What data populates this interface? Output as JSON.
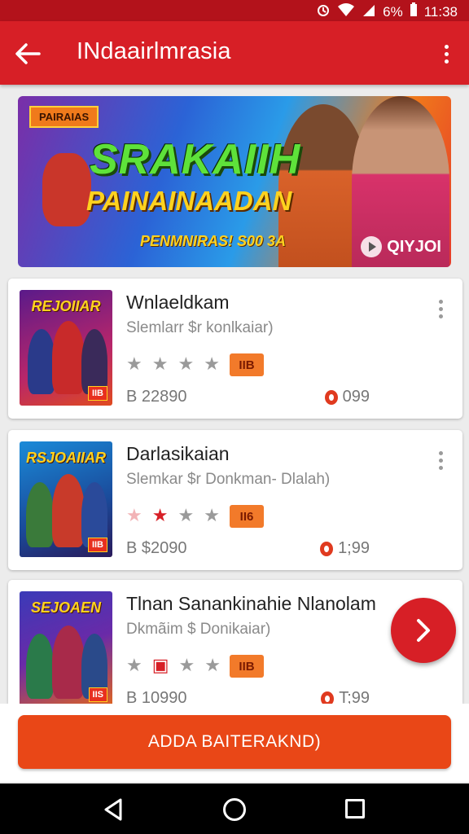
{
  "status_bar": {
    "percent": "6%",
    "time": "11:38"
  },
  "app_bar": {
    "title": "INdaairlmrasia"
  },
  "banner": {
    "tag": "PAIRAIAS",
    "title": "SRAKAIIH",
    "subtitle": "PAINAINAADAN",
    "footer": "PENMNIRAS! S00 3A",
    "play_label": "QIYJOI"
  },
  "games": [
    {
      "title": "Wnlaeldkam",
      "subtitle": "Slemlarr $r konlkaiar)",
      "thumb_title": "REJOIIAR",
      "thumb_badge": "IIB",
      "rating_badge": "IIB",
      "price_left": "B 22890",
      "price_right": "099"
    },
    {
      "title": "Darlasikaian",
      "subtitle": "Slemkar $r Donkman- Dlalah)",
      "thumb_title": "RSJOAIIAR",
      "thumb_badge": "IIB",
      "rating_badge": "II6",
      "price_left": "B $2090",
      "price_right": "1;99"
    },
    {
      "title": "Tlnan Sanankinahie Nlanolam",
      "subtitle": "Dkmãim $ Donikaiar)",
      "thumb_title": "SEJOAEN",
      "thumb_badge": "IIS",
      "rating_badge": "IIB",
      "price_left": "B 10990",
      "price_right": "T;99"
    }
  ],
  "cta": {
    "label": "ADDA BAITERAKND)"
  },
  "colors": {
    "primary": "#d71f26",
    "accent": "#e94717",
    "status_bar": "#b3121b"
  }
}
